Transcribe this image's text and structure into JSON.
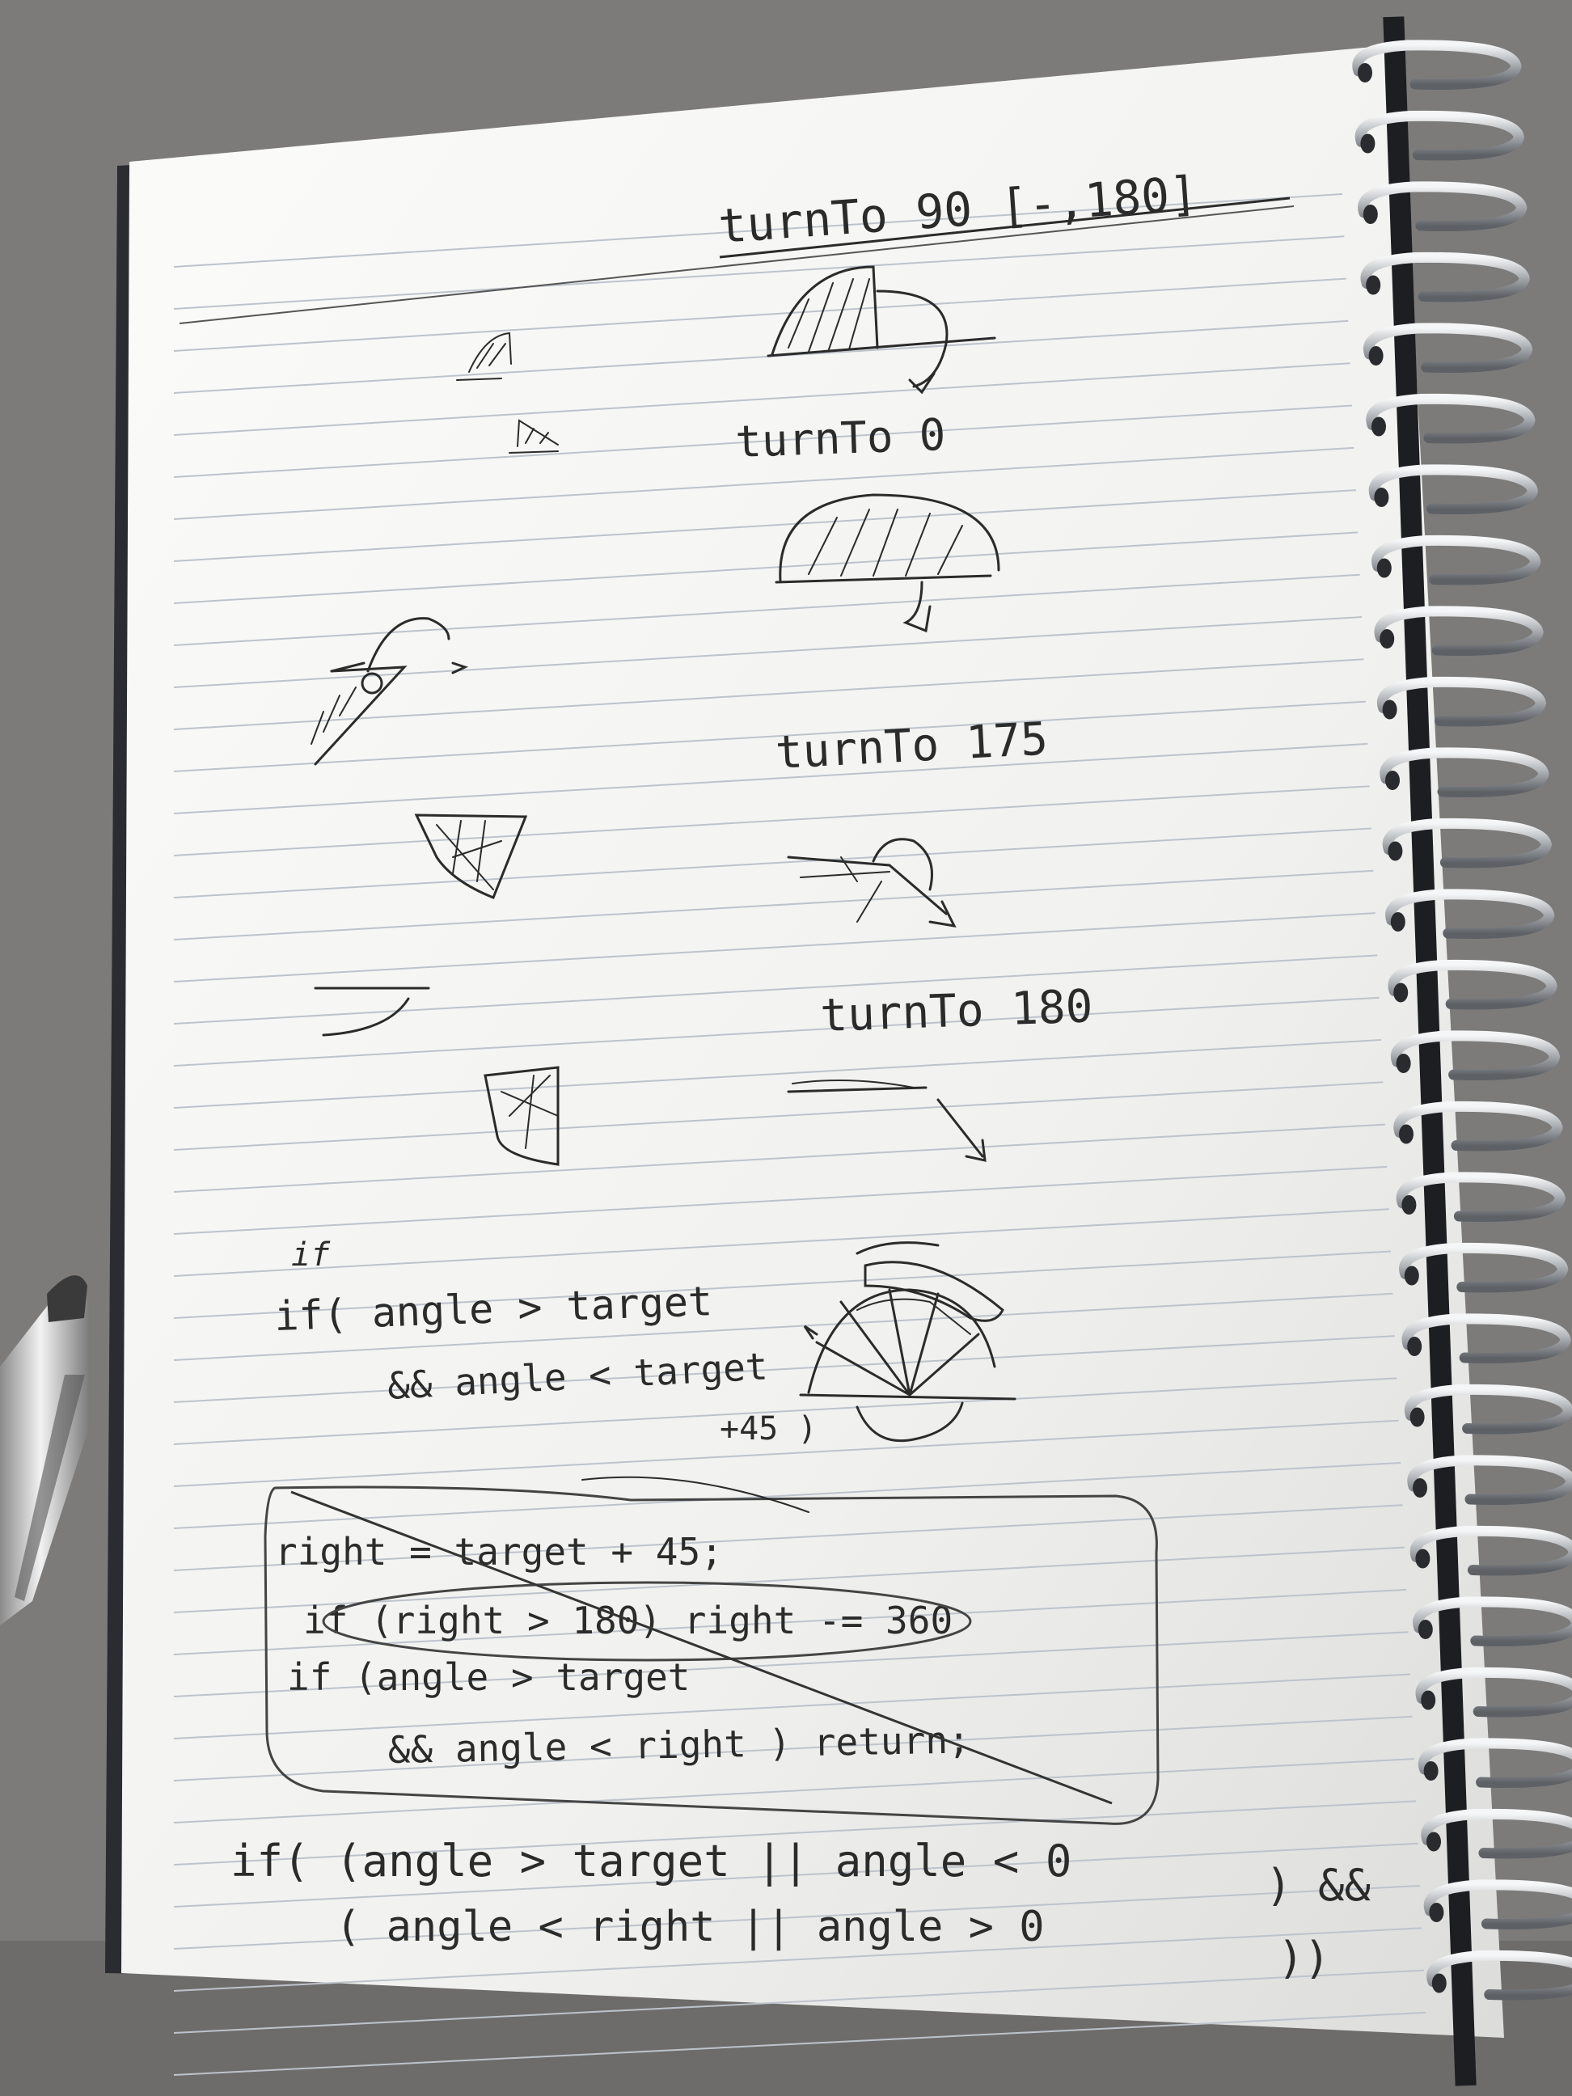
{
  "photo": {
    "subject": "spiral notebook page with handwritten pencil notes",
    "colors": {
      "desk": "#7e7d7b",
      "paper": "#f4f4f2",
      "ink": "#2b2b2b",
      "rule": "#b9bfc9",
      "spiral": "#cfd3d6"
    }
  },
  "notes": {
    "heading1": "turnTo 90 [-,180]",
    "heading2": "turnTo 0",
    "heading3": "turnTo 175",
    "heading4": "turnTo 180",
    "if_label": "if",
    "cond_line1": "if( angle > target",
    "cond_line2": "&& angle < target",
    "cond_line3": "+45 )",
    "box_line1": "right = target + 45;",
    "box_line2": "if (right > 180) right -= 360",
    "box_line3": "if (angle > target",
    "box_line4": "&& angle < right )  return;",
    "final_line1": "if( (angle > target  ||  angle < 0",
    "final_line1_end": ") &&",
    "final_line2": "( angle < right  ||  angle > 0",
    "final_line2_end": "))"
  }
}
